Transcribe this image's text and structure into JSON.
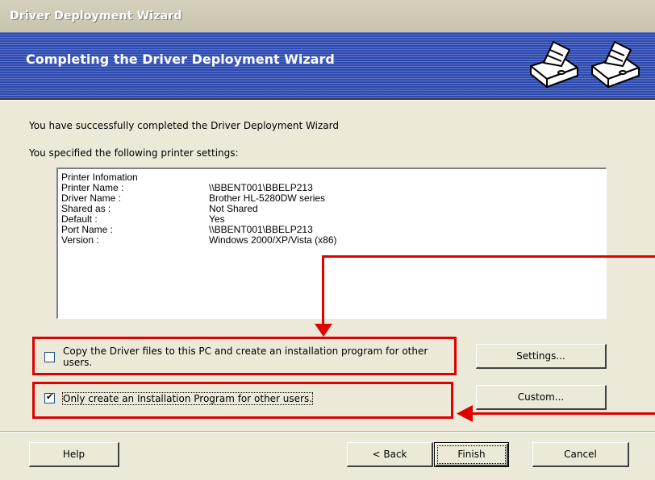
{
  "window": {
    "title": "Driver Deployment Wizard"
  },
  "banner": {
    "heading": "Completing the Driver Deployment Wizard"
  },
  "intro": {
    "success": "You have successfully completed the Driver Deployment Wizard",
    "specified": "You specified the following printer settings:"
  },
  "printer_info": {
    "header": "Printer Infomation",
    "rows": [
      {
        "label": "Printer Name :",
        "value": "\\\\BBENT001\\BBELP213"
      },
      {
        "label": "Driver Name :",
        "value": "Brother HL-5280DW series"
      },
      {
        "label": "Shared as :",
        "value": "Not Shared"
      },
      {
        "label": "Default :",
        "value": "Yes"
      },
      {
        "label": "Port Name :",
        "value": "\\\\BBENT001\\BBELP213"
      },
      {
        "label": "Version :",
        "value": "Windows 2000/XP/Vista (x86)"
      }
    ]
  },
  "options": {
    "copy_driver": {
      "label": "Copy the Driver files to this PC and create an installation program for other users.",
      "checked": false
    },
    "only_install": {
      "label": "Only create an Installation Program for other users.",
      "checked": true
    }
  },
  "buttons": {
    "settings": "Settings...",
    "custom": "Custom...",
    "help": "Help",
    "back": "< Back",
    "finish": "Finish",
    "cancel": "Cancel"
  },
  "colors": {
    "banner": "#2d4bb0",
    "annotation_red": "#e00000",
    "dialog": "#ece9d8"
  }
}
